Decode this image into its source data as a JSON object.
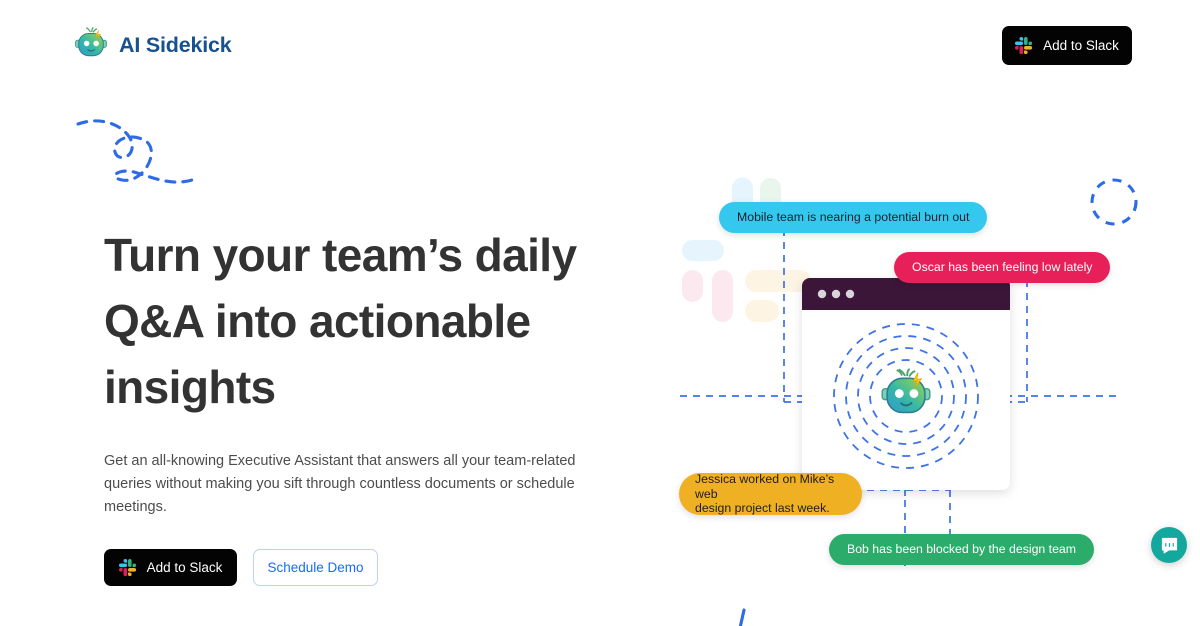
{
  "header": {
    "brand_name": "AI Sidekick",
    "brand_icon": "robot-mascot-icon",
    "cta_label": "Add to Slack",
    "cta_icon": "slack-logo-icon"
  },
  "hero": {
    "title": "Turn your team’s daily Q&A into actionable insights",
    "subtitle": "Get an all-knowing Executive Assistant that answers all your team-related queries without making you sift through countless documents or schedule meetings.",
    "primary_cta_label": "Add to Slack",
    "primary_cta_icon": "slack-logo-icon",
    "secondary_cta_label": "Schedule Demo"
  },
  "illustration": {
    "window_dots_icon": "window-traffic-lights-icon",
    "center_icon": "robot-mascot-icon",
    "watermark_icon": "slack-logo-watermark-icon",
    "bubbles": [
      {
        "id": "mobile-burnout",
        "text": "Mobile team is nearing a potential burn out",
        "color": "#35C8EE",
        "text_color": "#16212B"
      },
      {
        "id": "oscar-low",
        "text": "Oscar has been feeling low lately",
        "color": "#E8205A",
        "text_color": "#FFFFFF"
      },
      {
        "id": "jessica-design",
        "text": "Jessica worked on Mike’s web\ndesign project last week.",
        "color": "#EFB024",
        "text_color": "#22201A"
      },
      {
        "id": "bob-blocked",
        "text": "Bob has been blocked by the design team",
        "color": "#2BAC6B",
        "text_color": "#FFFFFF"
      }
    ]
  },
  "decorations": {
    "swirl_icon": "dashed-swirl-icon",
    "circle_icon": "dashed-circle-icon",
    "tick_icon": "dashed-tick-icon"
  },
  "chat_widget": {
    "icon": "intercom-chat-icon",
    "color": "#13A89E"
  },
  "theme": {
    "brand_blue": "#17518F",
    "link_blue": "#1A6AFF",
    "dashed_blue": "#2E6BE6",
    "black": "#030303",
    "heading": "#333333",
    "body_text": "#4C4C4C",
    "window_bar": "#3B1238"
  }
}
